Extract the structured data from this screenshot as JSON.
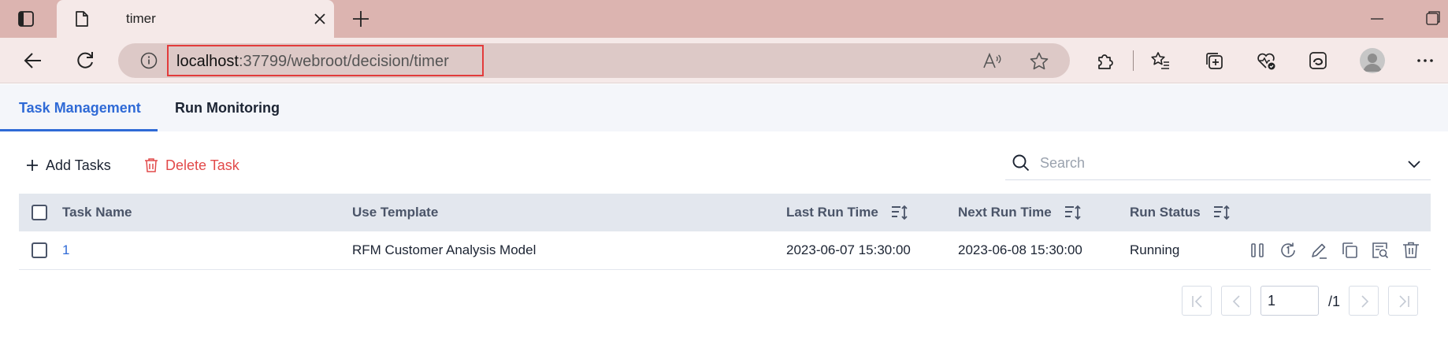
{
  "browser": {
    "tab_title": "timer",
    "url_host": "localhost",
    "url_rest": ":37799/webroot/decision/timer"
  },
  "app": {
    "tabs": [
      {
        "label": "Task Management",
        "active": true
      },
      {
        "label": "Run Monitoring",
        "active": false
      }
    ],
    "toolbar": {
      "add_label": "Add Tasks",
      "delete_label": "Delete Task"
    },
    "search": {
      "placeholder": "Search"
    },
    "table": {
      "headers": {
        "task_name": "Task Name",
        "use_template": "Use Template",
        "last_run_time": "Last Run Time",
        "next_run_time": "Next Run Time",
        "run_status": "Run Status"
      },
      "rows": [
        {
          "task_name": "1",
          "use_template": "RFM Customer Analysis Model",
          "last_run_time": "2023-06-07 15:30:00",
          "next_run_time": "2023-06-08 15:30:00",
          "run_status": "Running",
          "actions": [
            "pause-icon",
            "run-once-icon",
            "edit-icon",
            "copy-icon",
            "view-log-icon",
            "delete-icon"
          ]
        }
      ]
    },
    "pagination": {
      "current_page": "1",
      "total_pages": "/1"
    }
  },
  "colors": {
    "accent": "#2f6ad6",
    "danger": "#e24a4a",
    "titlebar": "#dcb4b0",
    "url_highlight": "#e23b3b"
  }
}
